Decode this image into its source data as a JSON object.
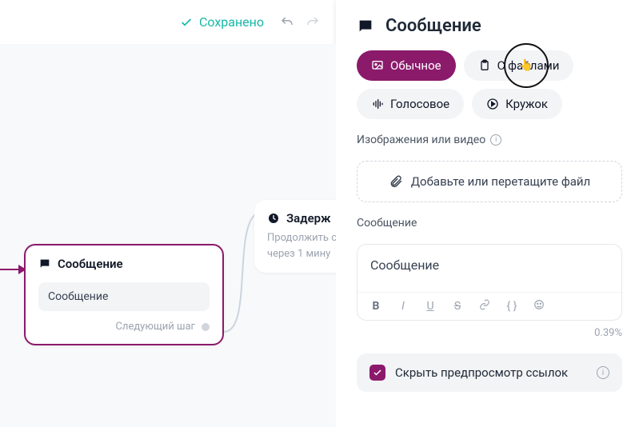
{
  "topbar": {
    "saved_label": "Сохранено"
  },
  "canvas": {
    "message_node": {
      "title": "Сообщение",
      "body": "Сообщение",
      "next_step": "Следующий шаг"
    },
    "delay_node": {
      "title": "Задерж",
      "line1": "Продолжить с",
      "line2": "через 1 мину"
    }
  },
  "panel": {
    "title": "Сообщение",
    "tabs": {
      "regular": "Обычное",
      "with_files": "С файлами",
      "voice": "Голосовое",
      "circle": "Кружок"
    },
    "media_label": "Изображения или видео",
    "dropzone": "Добавьте или перетащите файл",
    "message_label": "Сообщение",
    "editor_value": "Сообщение",
    "percent": "0.39%",
    "hide_preview": "Скрыть предпросмотр ссылок"
  }
}
